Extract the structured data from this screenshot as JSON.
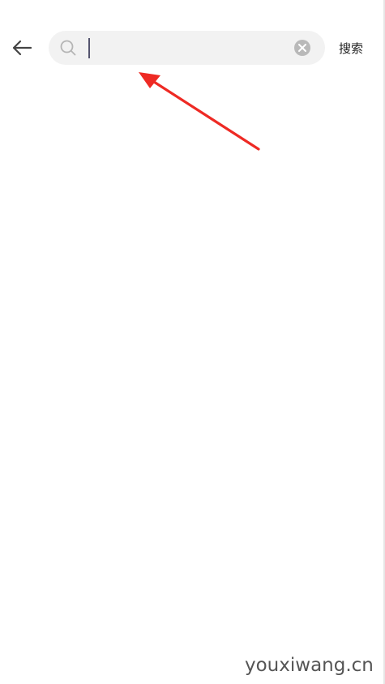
{
  "header": {
    "back_icon": "arrow-left-icon",
    "search": {
      "icon": "search-icon",
      "placeholder": "",
      "value": "",
      "clear_icon": "clear-circle-icon"
    },
    "submit_label": "搜索"
  },
  "watermark": {
    "text": "youxiwang.cn"
  },
  "colors": {
    "background": "#ffffff",
    "search_box": "#f2f2f2",
    "annotation_arrow": "#ee2a24"
  }
}
